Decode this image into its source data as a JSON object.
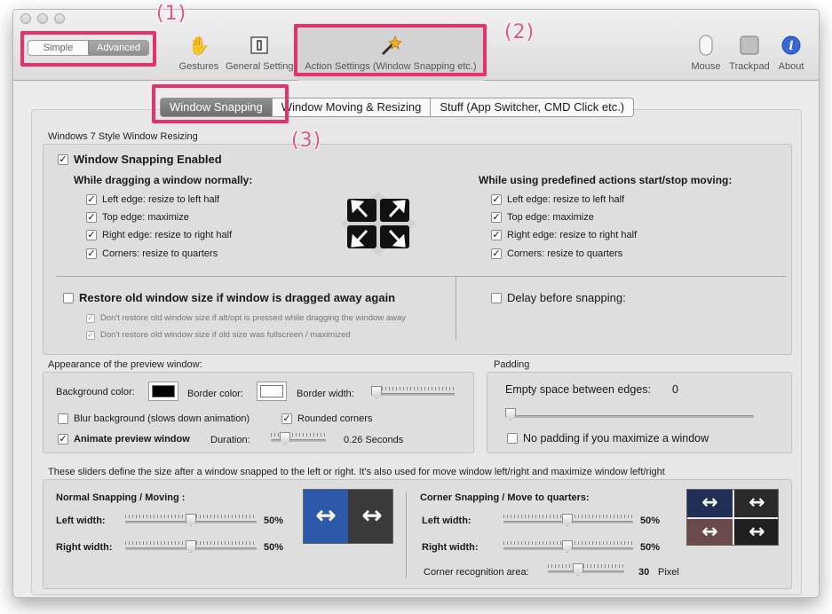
{
  "toolbar": {
    "mode_simple": "Simple",
    "mode_advanced": "Advanced",
    "gestures": "Gestures",
    "general": "General Setting",
    "action": "Action Settings (Window Snapping etc.)",
    "mouse": "Mouse",
    "trackpad": "Trackpad",
    "about": "About"
  },
  "callouts": {
    "c1": "(1)",
    "c2": "(2)",
    "c3": "(3)"
  },
  "tabs": [
    "Window Snapping",
    "Window Moving & Resizing",
    "Stuff (App Switcher, CMD Click etc.)"
  ],
  "snap": {
    "section": "Windows 7 Style Window Resizing",
    "enabled": "Window Snapping Enabled",
    "normal_heading": "While dragging a window normally:",
    "predef_heading": "While using predefined actions start/stop moving:",
    "left": "Left edge: resize to left half",
    "top": "Top edge: maximize",
    "right": "Right edge: resize to right half",
    "corners": "Corners: resize to quarters",
    "restore": "Restore old window size if window is dragged away again",
    "restore_alt": "Don't restore old window size if alt/opt is pressed while dragging the window away",
    "restore_full": "Don't restore old window size if old size was fullscreen / maximized",
    "delay": "Delay before snapping:"
  },
  "appearance": {
    "section": "Appearance of the preview window:",
    "bg_color": "Background color:",
    "border_color": "Border color:",
    "border_width": "Border width:",
    "blur": "Blur background (slows down animation)",
    "rounded": "Rounded corners",
    "animate": "Animate preview window",
    "duration_label": "Duration:",
    "duration_value": "0.26 Seconds",
    "bg_hex": "#000000",
    "border_hex": "#ffffff"
  },
  "padding": {
    "section": "Padding",
    "empty_space": "Empty space between edges:",
    "empty_value": "0",
    "no_padding": "No padding if you maximize a window"
  },
  "sizes": {
    "note": "These sliders define the size after a window snapped to the left or right. It's also used for move window left/right and maximize window left/right",
    "normal_heading": "Normal Snapping / Moving :",
    "corner_heading": "Corner Snapping / Move to quarters:",
    "left_width": "Left width:",
    "right_width": "Right width:",
    "normal_left_value": "50%",
    "normal_right_value": "50%",
    "corner_left_value": "50%",
    "corner_right_value": "50%",
    "corner_area_label": "Corner recognition area:",
    "corner_area_value": "30",
    "corner_area_unit": "Pixel"
  },
  "icons": [
    "gestures-icon",
    "general-settings-icon",
    "magic-wand-icon",
    "mouse-icon",
    "trackpad-icon",
    "about-icon"
  ],
  "colors": {
    "accent_callout": "#e8316b",
    "tab_selected": "#7f7f7f"
  }
}
